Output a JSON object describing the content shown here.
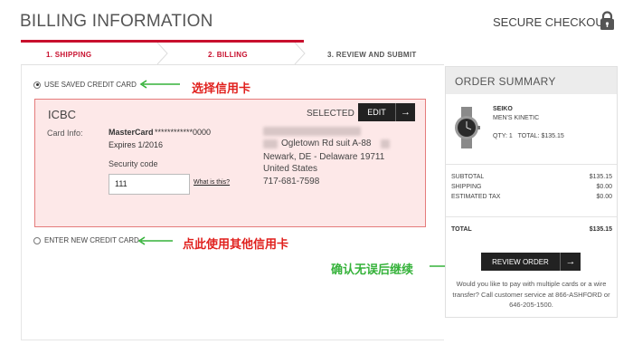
{
  "header": {
    "title": "BILLING INFORMATION",
    "secure_label": "SECURE CHECKOUT"
  },
  "steps": [
    {
      "label": "1. SHIPPING",
      "state": "completed"
    },
    {
      "label": "2. BILLING",
      "state": "active"
    },
    {
      "label": "3. REVIEW AND SUBMIT",
      "state": "upcoming"
    }
  ],
  "payment": {
    "saved_option_label": "USE SAVED CREDIT CARD",
    "new_option_label": "ENTER NEW CREDIT CARD",
    "saved_selected": true
  },
  "card": {
    "name": "ICBC",
    "selected_label": "SELECTED",
    "edit_label": "EDIT",
    "info_label": "Card Info:",
    "type": "MasterCard",
    "number": "************0000",
    "expires": "Expires 1/2016",
    "security_label": "Security code",
    "security_value": "111",
    "what_is_this": "What is this?",
    "address_line1": "Ogletown Rd suit A-88",
    "address_line2": "Newark, DE - Delaware 19711",
    "country": "United States",
    "phone": "717-681-7598"
  },
  "annotations": {
    "choose_card": "选择信用卡",
    "use_other_card": "点此使用其他信用卡",
    "confirm_continue": "确认无误后继续"
  },
  "summary": {
    "title": "ORDER SUMMARY",
    "item": {
      "brand": "SEIKO",
      "name": "MEN'S KINETIC",
      "qty_label": "QTY: 1",
      "total_label": "TOTAL: $135.15"
    },
    "rows": [
      {
        "label": "SUBTOTAL",
        "value": "$135.15"
      },
      {
        "label": "SHIPPING",
        "value": "$0.00"
      },
      {
        "label": "ESTIMATED TAX",
        "value": "$0.00"
      }
    ],
    "total": {
      "label": "TOTAL",
      "value": "$135.15"
    },
    "review_label": "REVIEW ORDER",
    "help_text": "Would you like to pay with multiple cards or a wire transfer? Call customer service at 866-ASHFORD or 646-205-1500."
  },
  "colors": {
    "accent_red": "#c8102e",
    "card_bg": "#fde8e8",
    "annotation_red": "#e0201d",
    "annotation_green": "#35b23a"
  }
}
